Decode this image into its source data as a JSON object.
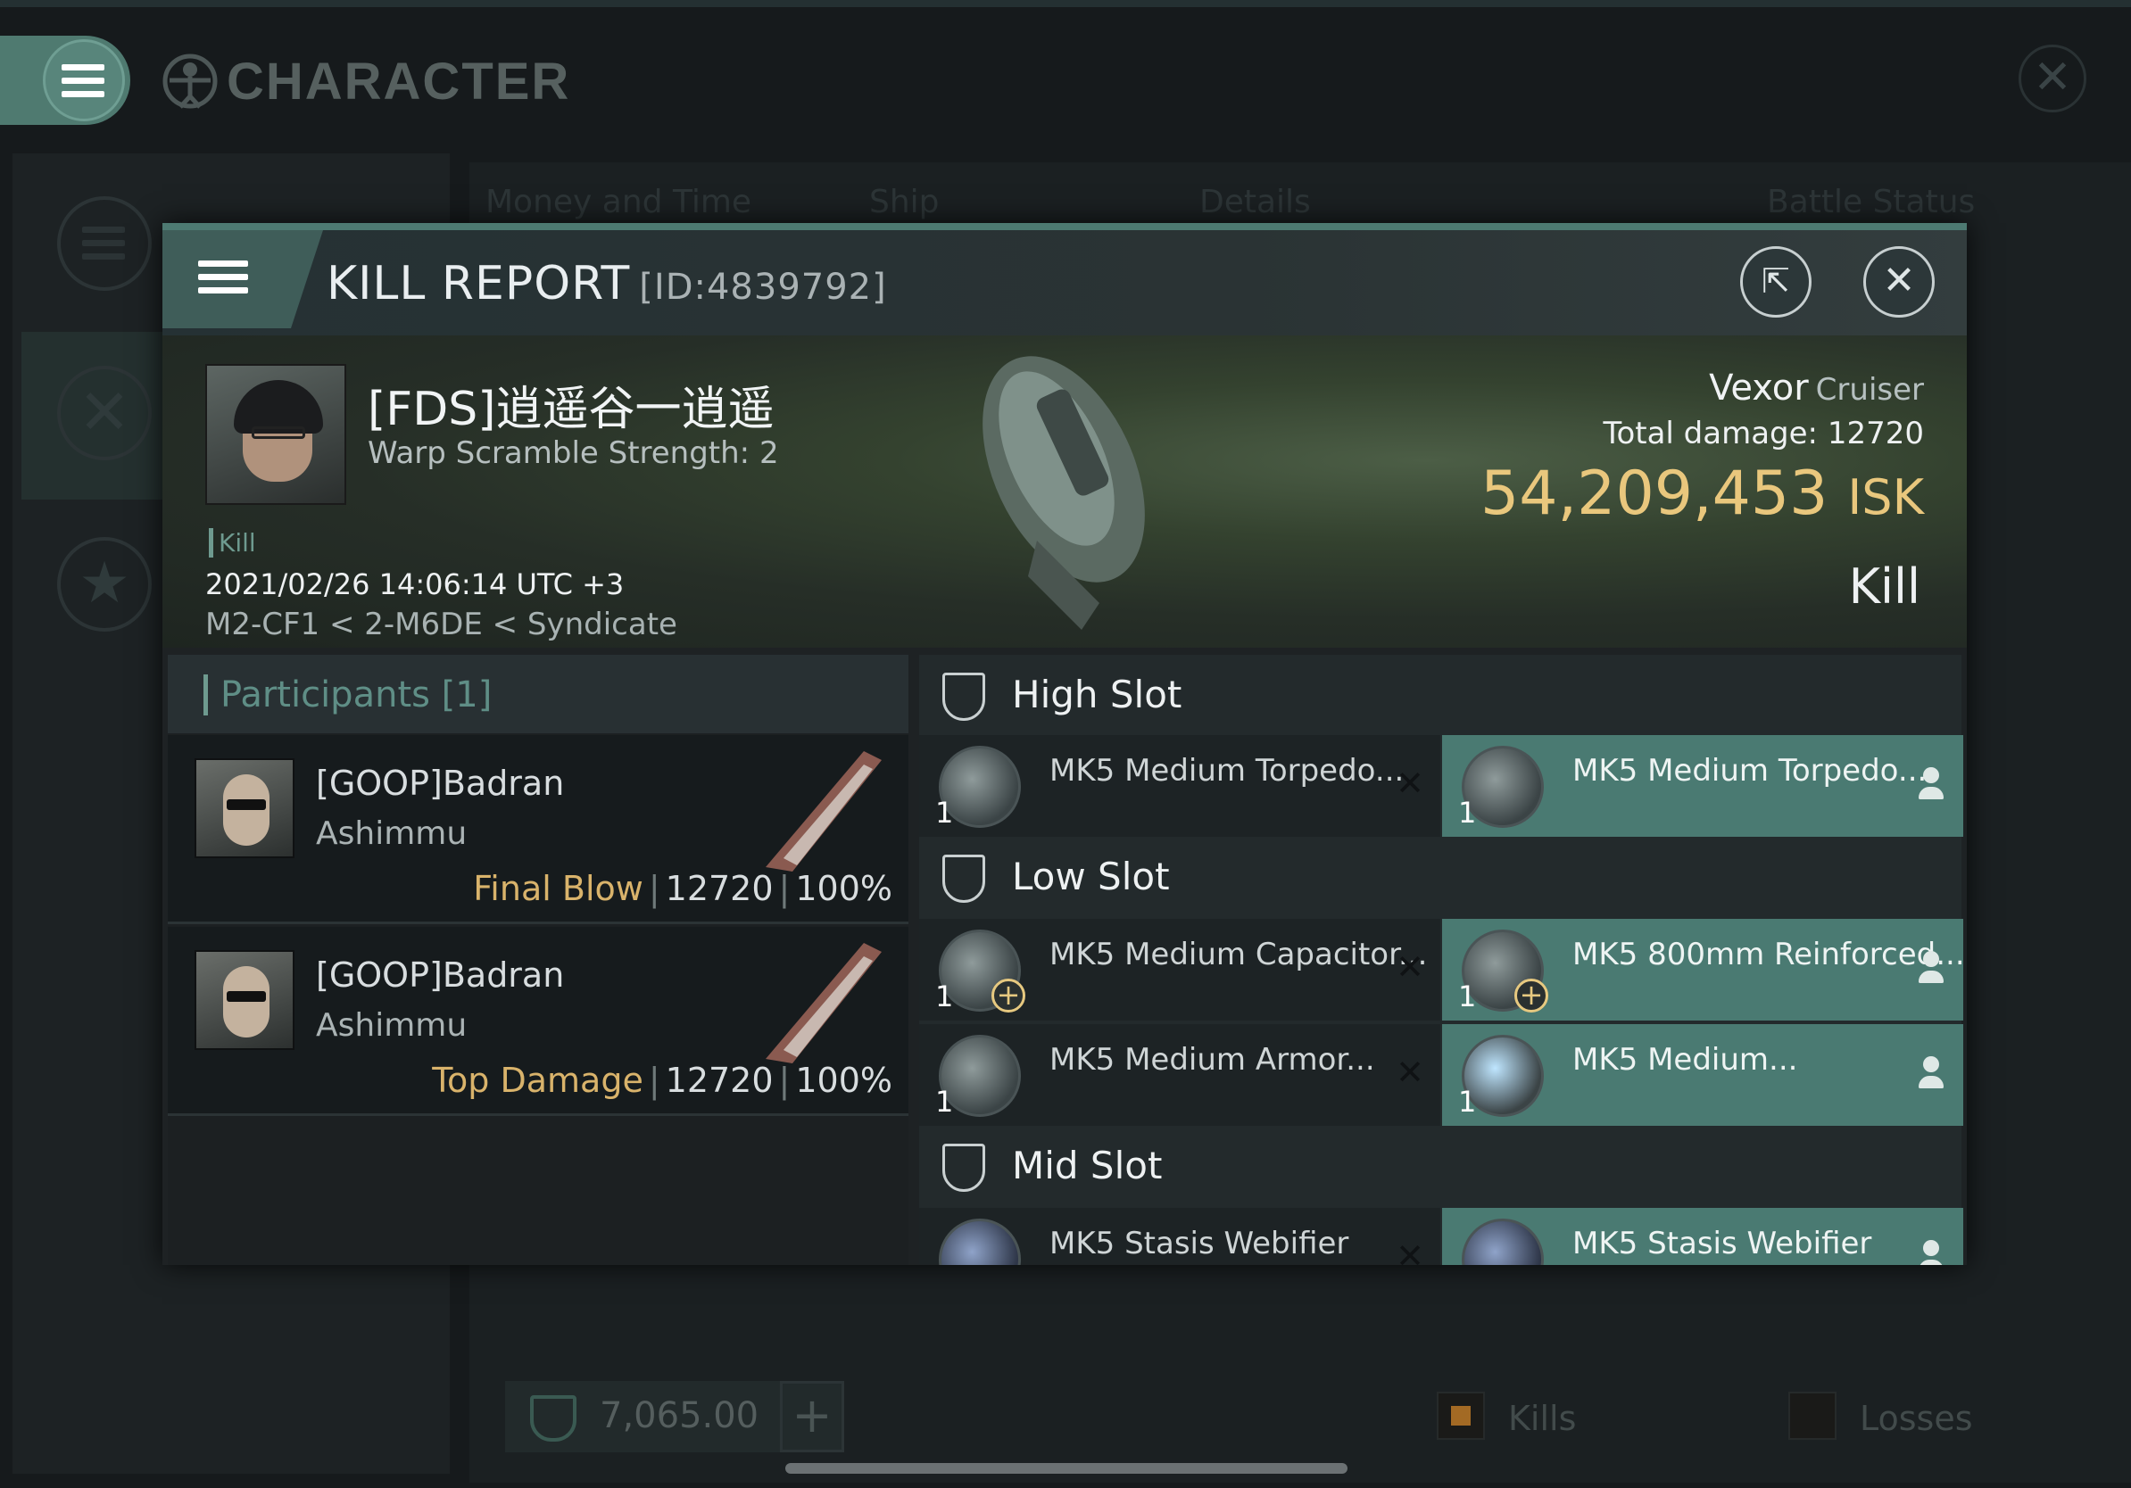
{
  "app": {
    "window_title": "CHARACTER",
    "background_tabs": [
      "Money and Time",
      "Ship",
      "Details",
      "Battle Status"
    ],
    "bottom": {
      "value": "7,065.00",
      "legend": [
        "Kills",
        "Losses"
      ]
    }
  },
  "kill_report": {
    "title": "KILL REPORT",
    "id": "[ID:4839792]",
    "victim": {
      "name": "[FDS]逍遥谷一逍遥",
      "warp_scramble": "Warp Scramble Strength: 2",
      "tag": "Kill",
      "datetime": "2021/02/26 14:06:14 UTC +3",
      "location": "M2-CF1 < 2-M6DE < Syndicate"
    },
    "ship": {
      "name": "Vexor",
      "class": "Cruiser"
    },
    "total_damage_label": "Total damage:",
    "total_damage": "12720",
    "isk_value": "54,209,453",
    "isk_unit": "ISK",
    "result": "Kill"
  },
  "participants": {
    "title": "Participants [1]",
    "rows": [
      {
        "name": "[GOOP]Badran",
        "ship": "Ashimmu",
        "role": "Final Blow",
        "damage": "12720",
        "percent": "100%"
      },
      {
        "name": "[GOOP]Badran",
        "ship": "Ashimmu",
        "role": "Top Damage",
        "damage": "12720",
        "percent": "100%"
      }
    ]
  },
  "fittings": {
    "high_slot": {
      "label": "High Slot",
      "destroyed": {
        "name": "MK5 Medium Torpedo...",
        "qty": "1"
      },
      "dropped": {
        "name": "MK5 Medium Torpedo...",
        "qty": "1"
      }
    },
    "low_slot": {
      "label": "Low Slot",
      "rows": [
        {
          "destroyed": {
            "name": "MK5 Medium Capacitor...",
            "qty": "1"
          },
          "dropped": {
            "name": "MK5 800mm Reinforced...",
            "qty": "1"
          }
        },
        {
          "destroyed": {
            "name": "MK5 Medium Armor...",
            "qty": "1"
          },
          "dropped": {
            "name": "MK5 Medium...",
            "qty": "1"
          }
        }
      ]
    },
    "mid_slot": {
      "label": "Mid Slot",
      "destroyed": {
        "name": "MK5 Stasis Webifier"
      },
      "dropped": {
        "name": "MK5 Stasis Webifier"
      }
    },
    "destroyed_marker": "✕"
  },
  "colors": {
    "accent": "#4d7a72",
    "isk": "#e9c77d",
    "role": "#d9b36b",
    "dropped_bg": "#4a7a72"
  }
}
